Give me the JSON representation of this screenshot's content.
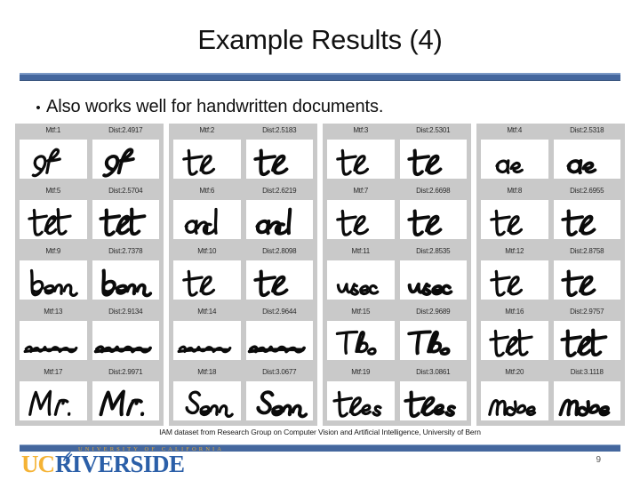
{
  "slide": {
    "title": "Example Results (4)",
    "bullet_marker": "•",
    "bullet_text": "Also works well for handwritten documents.",
    "caption": "IAM dataset from Research Group on Computer Vision and Artificial Intelligence, University of Bern",
    "page_number": "9"
  },
  "logo": {
    "uc": "UC",
    "university_line": "UNIVERSITY OF CALIFORNIA",
    "riverside": "RIVERSIDE",
    "seal_icon": "seal-icon"
  },
  "colors": {
    "accent_blue": "#44679E",
    "panel_gray": "#c9c9c9",
    "logo_gold": "#F5B335",
    "logo_blue": "#2B5FA8"
  },
  "results": {
    "columns": [
      {
        "cells": [
          {
            "mtf_label": "Mtf:1",
            "dist_label": "Dist:2.4917",
            "word": "of",
            "mtf_index": 1,
            "distance": 2.4917
          },
          {
            "mtf_label": "Mtf:5",
            "dist_label": "Dist:2.5704",
            "word": "that",
            "mtf_index": 5,
            "distance": 2.5704
          },
          {
            "mtf_label": "Mtf:9",
            "dist_label": "Dist:2.7378",
            "word": "been",
            "mtf_index": 9,
            "distance": 2.7378
          },
          {
            "mtf_label": "Mtf:13",
            "dist_label": "Dist:2.9134",
            "word": "scribble",
            "mtf_index": 13,
            "distance": 2.9134
          },
          {
            "mtf_label": "Mtf:17",
            "dist_label": "Dist:2.9971",
            "word": "Mr.",
            "mtf_index": 17,
            "distance": 2.9971
          }
        ]
      },
      {
        "cells": [
          {
            "mtf_label": "Mtf:2",
            "dist_label": "Dist:2.5183",
            "word": "the",
            "mtf_index": 2,
            "distance": 2.5183
          },
          {
            "mtf_label": "Mtf:6",
            "dist_label": "Dist:2.6219",
            "word": "and",
            "mtf_index": 6,
            "distance": 2.6219
          },
          {
            "mtf_label": "Mtf:10",
            "dist_label": "Dist:2.8098",
            "word": "the",
            "mtf_index": 10,
            "distance": 2.8098
          },
          {
            "mtf_label": "Mtf:14",
            "dist_label": "Dist:2.9644",
            "word": "scribble",
            "mtf_index": 14,
            "distance": 2.9644
          },
          {
            "mtf_label": "Mtf:18",
            "dist_label": "Dist:3.0677",
            "word": "Seen",
            "mtf_index": 18,
            "distance": 3.0677
          }
        ]
      },
      {
        "cells": [
          {
            "mtf_label": "Mtf:3",
            "dist_label": "Dist:2.5301",
            "word": "the",
            "mtf_index": 3,
            "distance": 2.5301
          },
          {
            "mtf_label": "Mtf:7",
            "dist_label": "Dist:2.6698",
            "word": "the",
            "mtf_index": 7,
            "distance": 2.6698
          },
          {
            "mtf_label": "Mtf:11",
            "dist_label": "Dist:2.8535",
            "word": "usec",
            "mtf_index": 11,
            "distance": 2.8535
          },
          {
            "mtf_label": "Mtf:15",
            "dist_label": "Dist:2.9689",
            "word": "The",
            "mtf_index": 15,
            "distance": 2.9689
          },
          {
            "mtf_label": "Mtf:19",
            "dist_label": "Dist:3.0861",
            "word": "the s",
            "mtf_index": 19,
            "distance": 3.0861
          }
        ]
      },
      {
        "cells": [
          {
            "mtf_label": "Mtf:4",
            "dist_label": "Dist:2.5318",
            "word": "are",
            "mtf_index": 4,
            "distance": 2.5318
          },
          {
            "mtf_label": "Mtf:8",
            "dist_label": "Dist:2.6955",
            "word": "the",
            "mtf_index": 8,
            "distance": 2.6955
          },
          {
            "mtf_label": "Mtf:12",
            "dist_label": "Dist:2.8758",
            "word": "the",
            "mtf_index": 12,
            "distance": 2.8758
          },
          {
            "mtf_label": "Mtf:16",
            "dist_label": "Dist:2.9757",
            "word": "that",
            "mtf_index": 16,
            "distance": 2.9757
          },
          {
            "mtf_label": "Mtf:20",
            "dist_label": "Dist:3.1118",
            "word": "mode",
            "mtf_index": 20,
            "distance": 3.1118
          }
        ]
      }
    ]
  }
}
